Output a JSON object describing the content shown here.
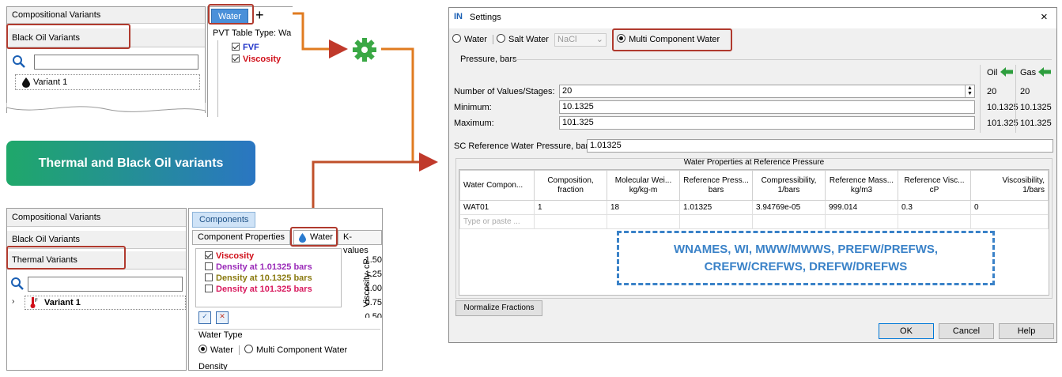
{
  "top_left": {
    "list": [
      "Compositional Variants",
      "Black Oil Variants"
    ],
    "variant": "Variant 1",
    "tab_water": "Water",
    "add_tab": "+",
    "pvt_label": "PVT Table Type: Wa",
    "checks": [
      {
        "label": "FVF",
        "color": "#1f33c8"
      },
      {
        "label": "Viscosity",
        "color": "#d0101a"
      }
    ]
  },
  "badge": {
    "text": "Thermal and Black Oil variants",
    "color_from": "#1fa86a",
    "color_to": "#2a76c2"
  },
  "bottom_left": {
    "list": [
      "Compositional Variants",
      "Black Oil Variants",
      "Thermal Variants"
    ],
    "variant": "Variant 1",
    "tab_components": "Components",
    "subtabs": [
      "Component Properties",
      "Water",
      "K-values"
    ],
    "checks": [
      {
        "label": "Viscosity",
        "checked": true,
        "color": "#d0101a"
      },
      {
        "label": "Density at 1.01325 bars",
        "checked": false,
        "color": "#9a2ab8"
      },
      {
        "label": "Density at 10.1325 bars",
        "checked": false,
        "color": "#8a7a10"
      },
      {
        "label": "Density at 101.325 bars",
        "checked": false,
        "color": "#d81a5e"
      }
    ],
    "axis_ticks": [
      "1.50",
      "1.25",
      "1.00",
      "0.75",
      "0.50"
    ],
    "axis_label": "Viscosity, cP",
    "water_type_title": "Water Type",
    "water_type_options": [
      "Water",
      "Multi Component Water"
    ],
    "density_label": "Density"
  },
  "settings": {
    "title": "Settings",
    "close": "×",
    "radio_water": "Water",
    "radio_salt": "Salt Water",
    "salt_select": "NaCl",
    "radio_multi": "Multi Component Water",
    "pressure_header": "Pressure, bars",
    "oil_label": "Oil",
    "gas_label": "Gas",
    "num_label": "Number of Values/Stages:",
    "num_value": "20",
    "min_label": "Minimum:",
    "min_value": "10.1325",
    "max_label": "Maximum:",
    "max_value": "101.325",
    "oil_values": [
      "20",
      "10.1325",
      "101.325"
    ],
    "gas_values": [
      "20",
      "10.1325",
      "101.325"
    ],
    "sc_label": "SC Reference Water Pressure, bars",
    "sc_value": "1.01325",
    "table_title": "Water Properties at Reference Pressure",
    "columns": [
      "Water Compon...",
      "Composition,\nfraction",
      "Molecular Wei...\nkg/kg-m",
      "Reference Press...\nbars",
      "Compressibility,\n1/bars",
      "Reference Mass...\nkg/m3",
      "Reference Visc...\ncP",
      "Viscosibility,\n1/bars"
    ],
    "rows": [
      [
        "WAT01",
        "1",
        "18",
        "1.01325",
        "3.94769e-05",
        "999.014",
        "0.3",
        "0"
      ]
    ],
    "placeholder_row": "Type or paste ...",
    "keywords_line1": "WNAMES, WI, MWW/MWWS, PREFW/PREFWS,",
    "keywords_line2": "CREFW/CREFWS, DREFW/DREFWS",
    "normalize_btn": "Normalize Fractions",
    "ok_btn": "OK",
    "cancel_btn": "Cancel",
    "help_btn": "Help"
  },
  "colors": {
    "highlight": "#b03a2e",
    "connector": "#e07b20",
    "keyword": "#3a82c8",
    "gear": "#3aa845"
  }
}
